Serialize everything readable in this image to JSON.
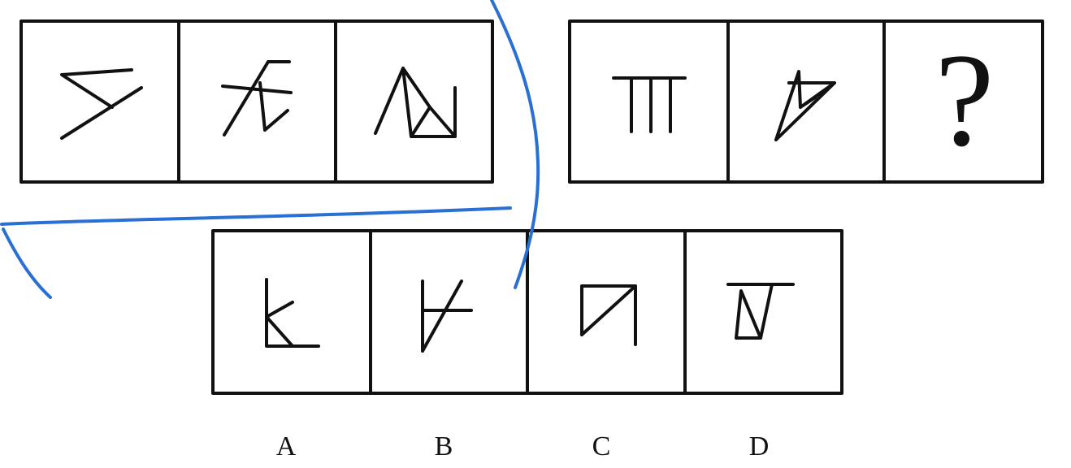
{
  "question_mark": "?",
  "option_labels": [
    "A",
    "B",
    "C",
    "D"
  ],
  "colors": {
    "stroke": "#111111",
    "annotation": "#2a6fd4",
    "background": "#ffffff"
  }
}
